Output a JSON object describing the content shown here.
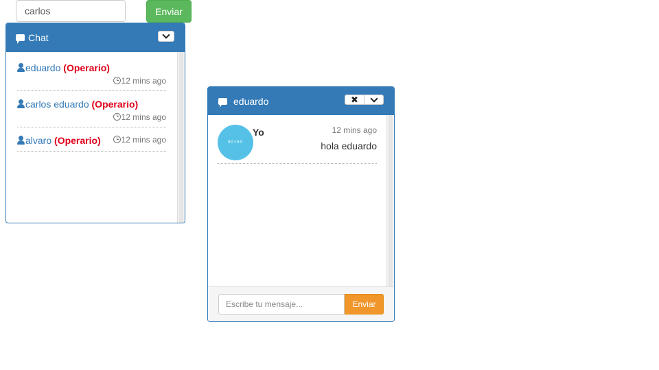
{
  "top_form": {
    "input_value": "carlos",
    "send_label": "Enviar"
  },
  "chat_list": {
    "title": "Chat",
    "users": [
      {
        "name": "eduardo",
        "role": "(Operario)",
        "time": "12 mins ago"
      },
      {
        "name": "carlos eduardo",
        "role": "(Operario)",
        "time": "12 mins ago"
      },
      {
        "name": "alvaro",
        "role": "(Operario)",
        "time": "12 mins ago"
      }
    ]
  },
  "chat_window": {
    "title": "eduardo",
    "messages": [
      {
        "sender": "Yo",
        "time": "12 mins ago",
        "text": "hola eduardo",
        "avatar_text": "50×50"
      }
    ],
    "input_placeholder": "Escribe tu mensaje...",
    "send_label": "Enviar"
  },
  "colors": {
    "primary": "#337ab7",
    "success": "#5cb85c",
    "warning": "#f0962b",
    "role": "#e0001b",
    "avatar": "#55c1e7"
  }
}
